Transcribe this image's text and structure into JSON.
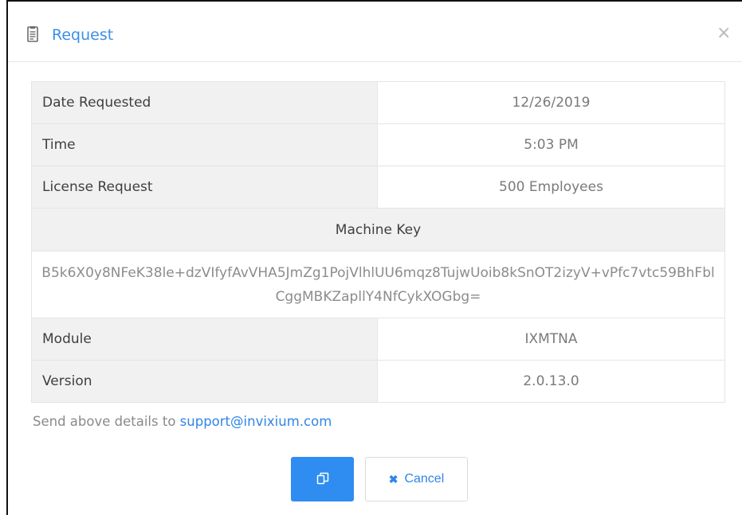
{
  "dialog": {
    "title": "Request",
    "icon": "document-icon",
    "close_glyph": "×",
    "accent_color": "#3c8ee8"
  },
  "details": {
    "rows": [
      {
        "label": "Date Requested",
        "value": "12/26/2019"
      },
      {
        "label": "Time",
        "value": "5:03 PM"
      },
      {
        "label": "License Request",
        "value": "500 Employees"
      }
    ],
    "machine_key_header": "Machine Key",
    "machine_key_value": "B5k6X0y8NFeK38le+dzVIfyfAvVHA5JmZg1PojVlhlUU6mqz8TujwUoib8kSnOT2izyV+vPfc7vtc59BhFblCggMBKZapllY4NfCykXOGbg=",
    "rows_after": [
      {
        "label": "Module",
        "value": "IXMTNA"
      },
      {
        "label": "Version",
        "value": "2.0.13.0"
      }
    ]
  },
  "note": {
    "text": "Send above details to ",
    "email": "support@invixium.com"
  },
  "buttons": {
    "copy_icon": "copy-icon",
    "cancel_glyph": "✖",
    "cancel_label": "Cancel",
    "primary_color": "#2f8cf0"
  }
}
